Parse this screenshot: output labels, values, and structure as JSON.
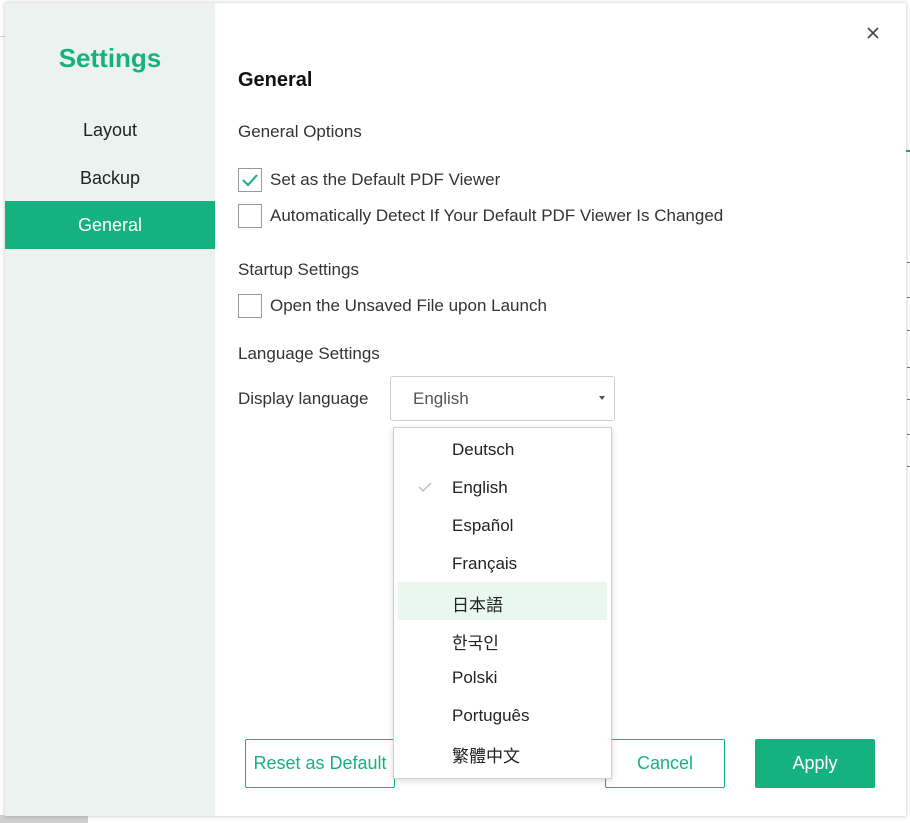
{
  "sidebar": {
    "title": "Settings",
    "items": [
      {
        "label": "Layout"
      },
      {
        "label": "Backup"
      },
      {
        "label": "General"
      }
    ]
  },
  "main": {
    "section_title": "General",
    "general_options": {
      "label": "General Options",
      "default_viewer": {
        "label": "Set as the Default PDF Viewer",
        "checked": true
      },
      "auto_detect": {
        "label": "Automatically Detect If Your Default PDF Viewer Is Changed",
        "checked": false
      }
    },
    "startup_settings": {
      "label": "Startup Settings",
      "open_unsaved": {
        "label": "Open the Unsaved File upon Launch",
        "checked": false
      }
    },
    "language_settings": {
      "label": "Language Settings",
      "display_language_label": "Display language",
      "selected": "English",
      "options": [
        {
          "label": "Deutsch"
        },
        {
          "label": "English",
          "selected": true
        },
        {
          "label": "Español"
        },
        {
          "label": "Français"
        },
        {
          "label": "日本語",
          "hover": true
        },
        {
          "label": "한국인"
        },
        {
          "label": "Polski"
        },
        {
          "label": "Português"
        },
        {
          "label": "繁體中文"
        }
      ]
    }
  },
  "footer": {
    "reset_label": "Reset as Default",
    "cancel_label": "Cancel",
    "apply_label": "Apply"
  },
  "icons": {
    "close": "close-icon",
    "check": "check-icon",
    "dropdown": "chevron-down-icon"
  },
  "colors": {
    "accent": "#15b280",
    "sidebar_bg": "#ebf2f0",
    "hover_bg": "#e8f8ef"
  }
}
